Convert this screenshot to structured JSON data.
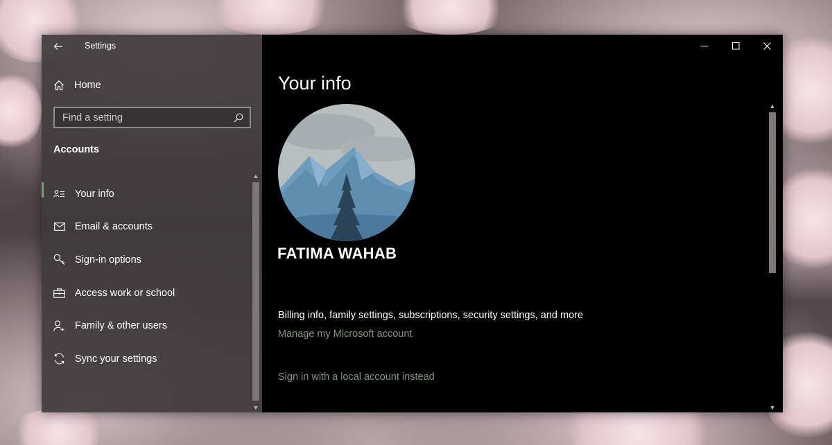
{
  "window": {
    "app_title": "Settings"
  },
  "sidebar": {
    "home_label": "Home",
    "search_placeholder": "Find a setting",
    "section_title": "Accounts",
    "items": [
      {
        "label": "Your info",
        "icon": "person-card-icon",
        "active": true
      },
      {
        "label": "Email & accounts",
        "icon": "mail-icon",
        "active": false
      },
      {
        "label": "Sign-in options",
        "icon": "key-icon",
        "active": false
      },
      {
        "label": "Access work or school",
        "icon": "briefcase-icon",
        "active": false
      },
      {
        "label": "Family & other users",
        "icon": "person-add-icon",
        "active": false
      },
      {
        "label": "Sync your settings",
        "icon": "sync-icon",
        "active": false
      }
    ]
  },
  "main": {
    "page_title": "Your info",
    "user_name": "FATIMA WAHAB",
    "billing_text": "Billing info, family settings, subscriptions, security settings, and more",
    "manage_link": "Manage my Microsoft account",
    "local_link": "Sign in with a local account instead"
  },
  "colors": {
    "accent_link": "#7d9879",
    "active_indicator": "#7f9a7c",
    "sidebar_bg": "#403a3c",
    "main_bg": "#000000"
  }
}
